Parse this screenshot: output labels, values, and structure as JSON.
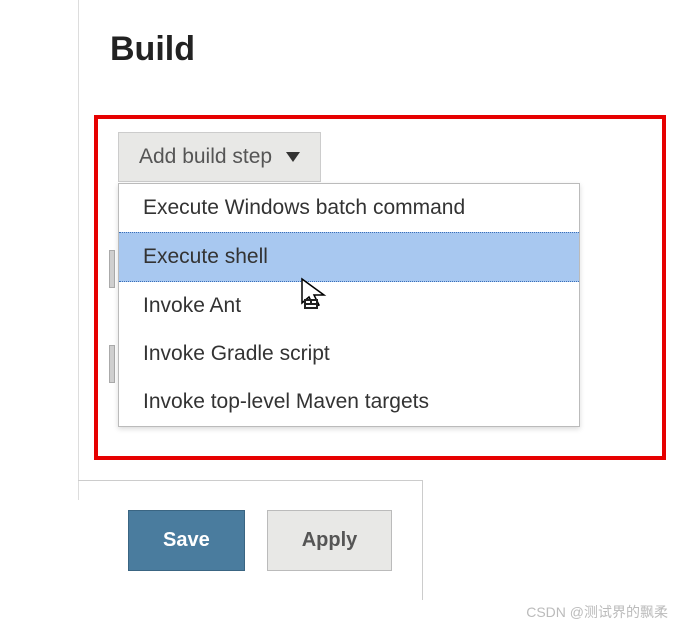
{
  "section": {
    "title": "Build"
  },
  "addButton": {
    "label": "Add build step"
  },
  "dropdown": {
    "items": [
      {
        "label": "Execute Windows batch command",
        "selected": false
      },
      {
        "label": "Execute shell",
        "selected": true
      },
      {
        "label": "Invoke Ant",
        "selected": false
      },
      {
        "label": "Invoke Gradle script",
        "selected": false
      },
      {
        "label": "Invoke top-level Maven targets",
        "selected": false
      }
    ]
  },
  "footer": {
    "saveLabel": "Save",
    "applyLabel": "Apply"
  },
  "watermark": "CSDN @测试界的飘柔"
}
